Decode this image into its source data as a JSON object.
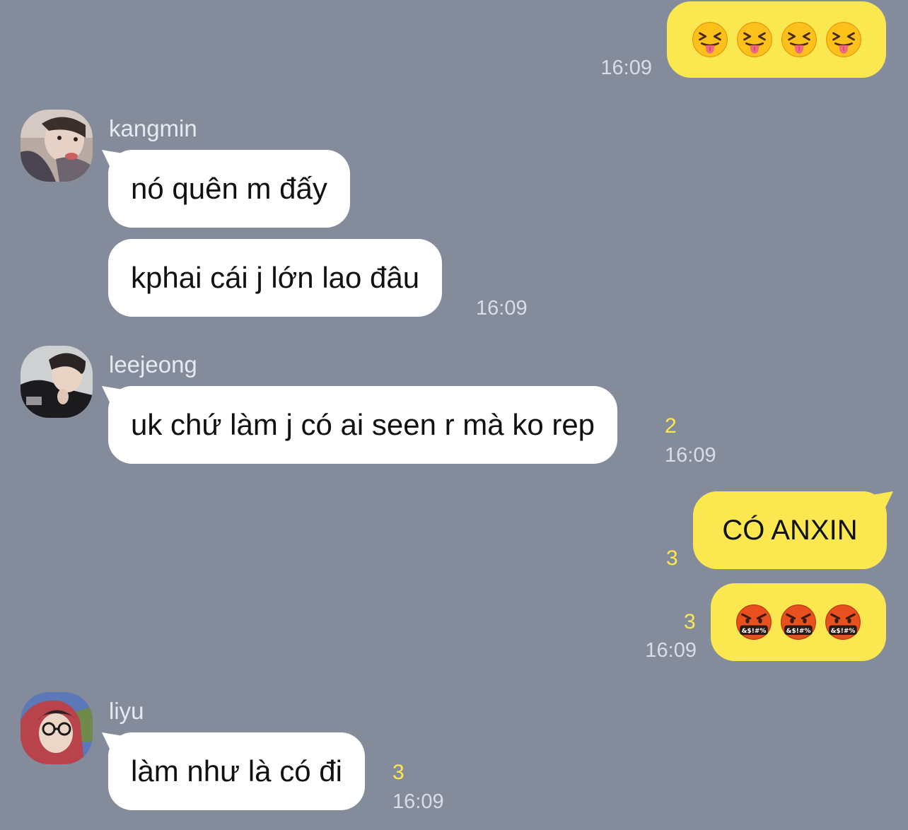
{
  "messages": {
    "m1": {
      "time": "16:09"
    },
    "kangmin": {
      "name": "kangmin",
      "line1": "nó quên m đấy",
      "line2": "kphai cái j lớn lao đâu",
      "time": "16:09"
    },
    "leejeong": {
      "name": "leejeong",
      "text": "uk chứ làm j có ai seen r mà ko rep",
      "unread": "2",
      "time": "16:09"
    },
    "m4": {
      "text": "CÓ ANXIN",
      "unread": "3"
    },
    "m5": {
      "unread": "3",
      "time": "16:09"
    },
    "liyu": {
      "name": "liyu",
      "text": "làm như là có đi",
      "unread": "3",
      "time": "16:09"
    }
  },
  "icons": {
    "m1_emoji": "squinting-face-with-tongue-icon",
    "m5_emoji": "face-with-symbols-on-mouth-icon"
  },
  "colors": {
    "background": "#848c9c",
    "outgoing_bubble": "#fbe850",
    "incoming_bubble": "#ffffff",
    "unread_count": "#fbe850",
    "timestamp": "#d9dde6"
  }
}
